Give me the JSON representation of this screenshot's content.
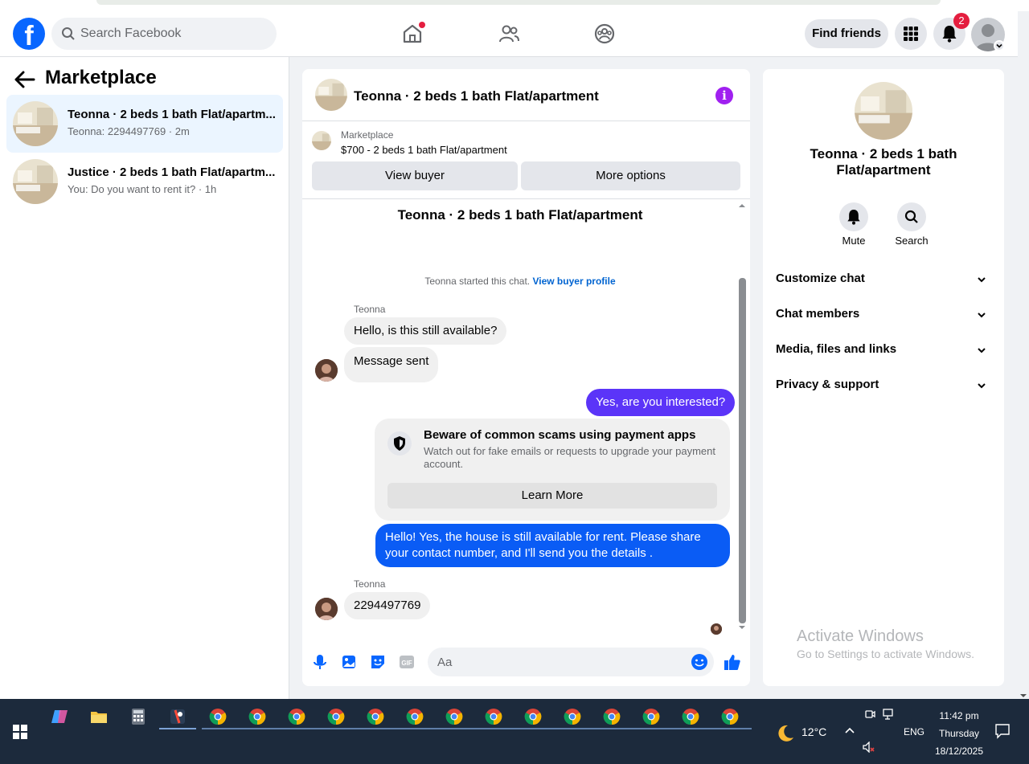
{
  "header": {
    "logo": "f",
    "search_placeholder": "Search Facebook",
    "find_friends_label": "Find friends",
    "notification_count": "2"
  },
  "left": {
    "back_label": "←",
    "title": "Marketplace",
    "conversations": [
      {
        "title": "Teonna · 2 beds 1 bath Flat/apartm...",
        "sub": "Teonna: 2294497769 · 2m"
      },
      {
        "title": "Justice · 2 beds 1 bath Flat/apartm...",
        "sub": "You: Do you want to rent it? · 1h"
      }
    ]
  },
  "chat": {
    "title": "Teonna · 2 beds 1 bath Flat/apartment",
    "info_icon": "i",
    "listing_source": "Marketplace",
    "listing_desc": "$700 - 2 beds 1 bath Flat/apartment",
    "view_buyer_label": "View buyer",
    "more_options_label": "More options",
    "convo_title": "Teonna · 2 beds 1 bath Flat/apartment",
    "started_text": "Teonna started this chat.",
    "view_profile_link": "View buyer profile",
    "messages": {
      "sender1": "Teonna",
      "m1": "Hello, is this still available?",
      "m2": "Message sent",
      "m3": "Yes, are you interested?",
      "scam_title": "Beware of common scams using payment apps",
      "scam_body": "Watch out for fake emails or requests to upgrade your payment account.",
      "learn_more": "Learn More",
      "m4": "Hello! Yes, the house is still available for rent. Please share your contact number, and I'll send you the details .",
      "sender2": "Teonna",
      "m5": "2294497769"
    },
    "composer_placeholder": "Aa"
  },
  "right": {
    "title": "Teonna · 2 beds 1 bath Flat/apartment",
    "mute_label": "Mute",
    "search_label": "Search",
    "rows": [
      "Customize chat",
      "Chat members",
      "Media, files and links",
      "Privacy & support"
    ]
  },
  "watermark": {
    "line1": "Activate Windows",
    "line2": "Go to Settings to activate Windows."
  },
  "taskbar": {
    "temperature": "12°C",
    "language": "ENG",
    "time": "11:42 pm",
    "day": "Thursday",
    "date": "18/12/2025"
  },
  "colors": {
    "brand_blue": "#0866ff",
    "outgoing_purple": "#5b34f8",
    "outgoing_blue": "#0a5cf5",
    "badge_red": "#e41e3f"
  }
}
